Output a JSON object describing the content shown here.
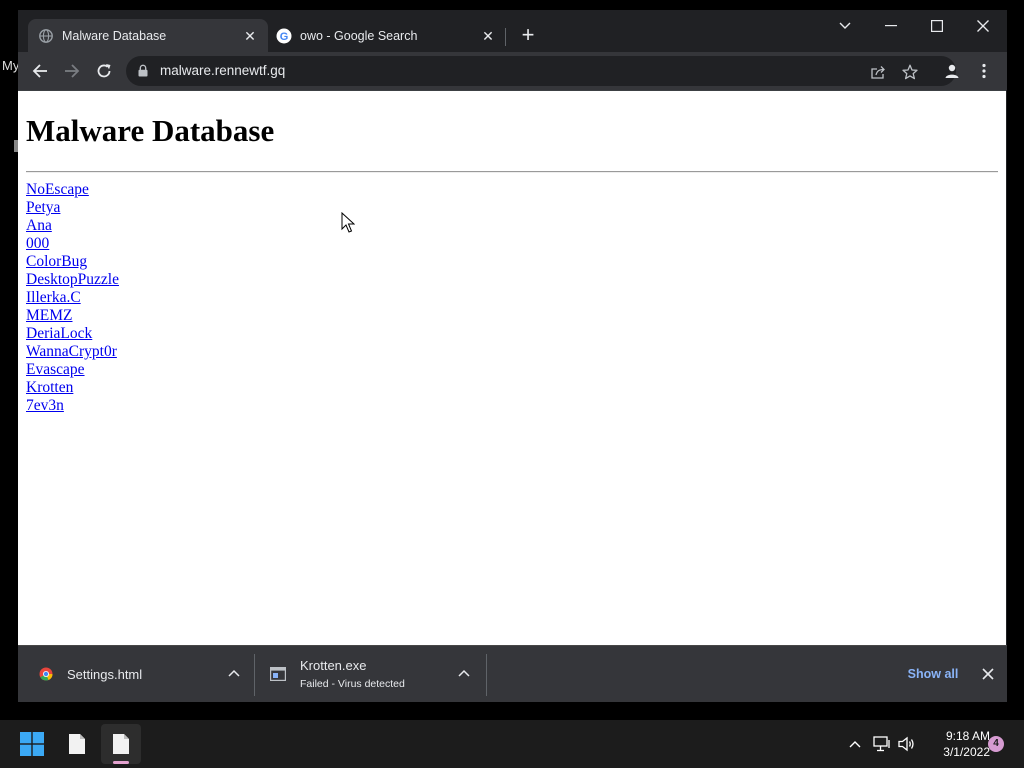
{
  "desktop": {
    "partial_text": "My"
  },
  "browser": {
    "tabs": [
      {
        "title": "Malware Database",
        "active": true,
        "favicon": "globe-icon"
      },
      {
        "title": "owo - Google Search",
        "active": false,
        "favicon": "google-icon"
      }
    ],
    "address": {
      "url": "malware.rennewtf.gq"
    }
  },
  "page": {
    "heading": "Malware Database",
    "links": [
      "NoEscape",
      "Petya",
      "Ana",
      "000",
      "ColorBug",
      "DesktopPuzzle",
      "Illerka.C",
      "MEMZ",
      "DeriaLock",
      "WannaCrypt0r",
      "Evascape",
      "Krotten",
      "7ev3n"
    ]
  },
  "downloads": {
    "items": [
      {
        "name": "Settings.html",
        "status": "",
        "icon": "chrome-icon"
      },
      {
        "name": "Krotten.exe",
        "status": "Failed - Virus detected",
        "icon": "exe-icon"
      }
    ],
    "show_all_label": "Show all"
  },
  "taskbar": {
    "time": "9:18 AM",
    "date": "3/1/2022",
    "notification_count": "4"
  },
  "colors": {
    "link": "#0000ee",
    "accent_link": "#8ab4f8",
    "browser_dark": "#202124",
    "toolbar": "#35363a",
    "notification_badge": "#d69bd1"
  }
}
